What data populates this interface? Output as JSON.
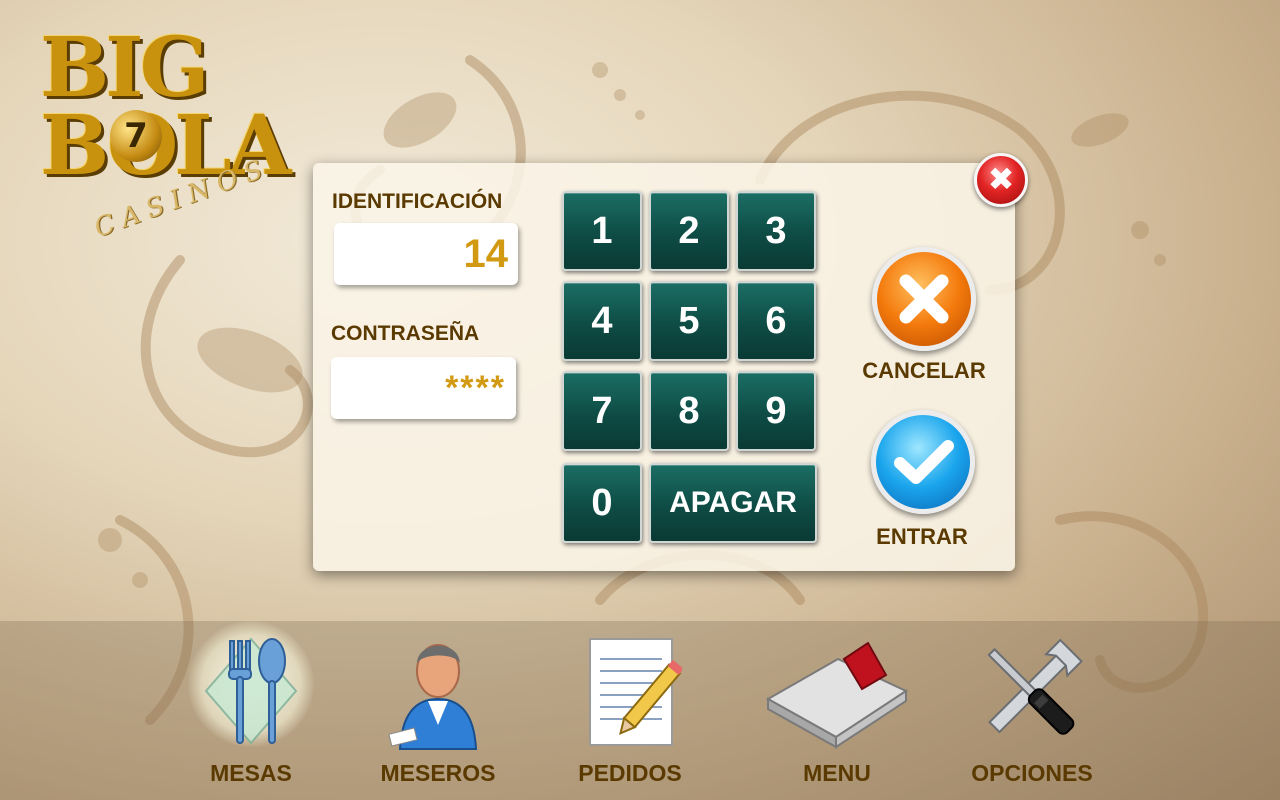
{
  "logo": {
    "main": "BIG BOLA",
    "ball_number": "7",
    "sub": "CASINOS"
  },
  "login": {
    "id_label": "IDENTIFICACIÓN",
    "id_value": "14",
    "password_label": "CONTRASEÑA",
    "password_value": "****",
    "keypad": [
      "1",
      "2",
      "3",
      "4",
      "5",
      "6",
      "7",
      "8",
      "9",
      "0"
    ],
    "off_label": "APAGAR",
    "cancel_label": "CANCELAR",
    "enter_label": "ENTRAR",
    "close_symbol": "✖"
  },
  "nav": {
    "items": [
      {
        "label": "MESAS",
        "icon": "cutlery-icon"
      },
      {
        "label": "MESEROS",
        "icon": "waiter-icon"
      },
      {
        "label": "PEDIDOS",
        "icon": "order-pad-icon"
      },
      {
        "label": "MENU",
        "icon": "menu-book-icon"
      },
      {
        "label": "OPCIONES",
        "icon": "tools-icon"
      }
    ]
  },
  "colors": {
    "accent_gold": "#d29a12",
    "label_brown": "#5a3a00",
    "key_teal": "#0e4c45",
    "cancel_orange": "#f47a0c",
    "enter_blue": "#1aa5ec",
    "close_red": "#e22424"
  }
}
